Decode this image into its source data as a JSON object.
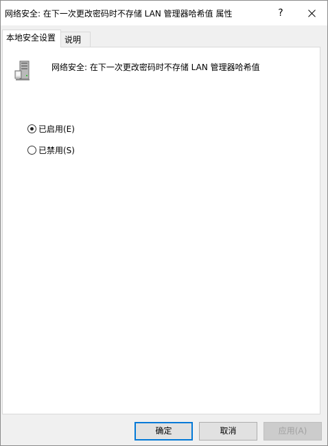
{
  "window": {
    "title": "网络安全: 在下一次更改密码时不存储 LAN 管理器哈希值 属性",
    "help_label": "?",
    "close_icon": "close-icon"
  },
  "tabs": [
    {
      "label": "本地安全设置",
      "active": true
    },
    {
      "label": "说明",
      "active": false
    }
  ],
  "policy": {
    "icon": "server-policy-icon",
    "name": "网络安全: 在下一次更改密码时不存储 LAN 管理器哈希值"
  },
  "options": {
    "enabled_label": "已启用(E)",
    "disabled_label": "已禁用(S)",
    "selected": "enabled"
  },
  "buttons": {
    "ok_label": "确定",
    "cancel_label": "取消",
    "apply_label": "应用(A)",
    "apply_disabled": true
  },
  "colors": {
    "accent": "#0078d7",
    "dialog_bg": "#f0f0f0",
    "panel_bg": "#ffffff"
  }
}
